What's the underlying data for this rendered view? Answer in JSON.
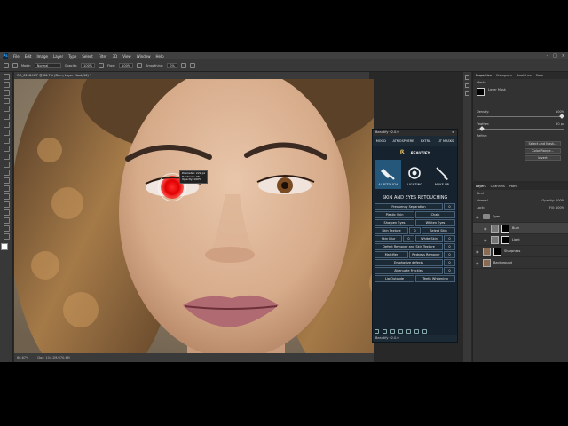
{
  "menubar": {
    "app_icon": "Ps",
    "items": [
      "File",
      "Edit",
      "Image",
      "Layer",
      "Type",
      "Select",
      "Filter",
      "3D",
      "View",
      "Window",
      "Help"
    ]
  },
  "options": {
    "mode_label": "Mode:",
    "mode_value": "Normal",
    "opacity_label": "Opacity:",
    "opacity_value": "100%",
    "flow_label": "Flow:",
    "flow_value": "100%",
    "smoothing_label": "Smoothing:",
    "smoothing_value": "0%"
  },
  "document": {
    "tab": "OO_0218.NEF @ 66.7% (Burn, Layer Mask/16) *",
    "zoom": "66.67%",
    "doc_info": "Doc: 104.2M/370.4M"
  },
  "brush_tip": {
    "line1": "Diameter: 222 px",
    "line2": "Hardness: 0%",
    "line3": "Opacity: 100%"
  },
  "beautify": {
    "title": "Beautify v2.0.0",
    "tabs": [
      "MOOD",
      "ATMOSPHERE",
      "EXTRA",
      "LIT MASKS"
    ],
    "logo": "BEAUTIFY",
    "modes": [
      {
        "label": "AI RETOUCH"
      },
      {
        "label": "LIGHTING"
      },
      {
        "label": "MAKE-UP"
      }
    ],
    "section": "SKIN AND EYES RETOUCHING",
    "rows": [
      [
        {
          "label": "Frequency Separation",
          "w": 2
        },
        {
          "label": "0",
          "num": true
        }
      ],
      [
        {
          "label": "Plastic Skin"
        },
        {
          "label": "Chalk"
        }
      ],
      [
        {
          "label": "Sharpen Eyes"
        },
        {
          "label": "Whiten Eyes"
        }
      ],
      [
        {
          "label": "Skin Texture"
        },
        {
          "label": "0",
          "num": true
        },
        {
          "label": "Select Skin"
        }
      ],
      [
        {
          "label": "Skin Blur"
        },
        {
          "label": "0",
          "num": true
        },
        {
          "label": "White Skin"
        },
        {
          "label": "0",
          "num": true
        }
      ],
      [
        {
          "label": "Defect Remover and Skin Texture",
          "w": 2
        },
        {
          "label": "0",
          "num": true
        }
      ],
      [
        {
          "label": "Mattifier"
        },
        {
          "label": "Redness Remover"
        },
        {
          "label": "0",
          "num": true
        }
      ],
      [
        {
          "label": "Emphasize defects",
          "w": 2
        },
        {
          "label": "0",
          "num": true
        }
      ],
      [
        {
          "label": "Attenuate Freckles",
          "w": 2
        },
        {
          "label": "0",
          "num": true
        }
      ],
      [
        {
          "label": "Lip Outcode"
        },
        {
          "label": "Teeth Whitening"
        }
      ]
    ],
    "footer": "Beautify v2.0.0"
  },
  "properties": {
    "tabs": [
      "Properties",
      "Histogram",
      "Swatches",
      "Color"
    ],
    "mode": "Masks",
    "layer_mask": "Layer Mask",
    "density_label": "Density:",
    "density_value": "100%",
    "feather_label": "Feather:",
    "feather_value": "50 px",
    "refine_label": "Refine:",
    "select_mask": "Select and Mask...",
    "color_range": "Color Range...",
    "invert": "Invert"
  },
  "layers": {
    "tabs": [
      "Layers",
      "Channels",
      "Paths"
    ],
    "kind": "Kind",
    "blend": "Normal",
    "opacity_label": "Opacity:",
    "opacity_value": "100%",
    "lock_label": "Lock:",
    "fill_label": "Fill:",
    "fill_value": "100%",
    "items": [
      {
        "name": "Eyes",
        "type": "group"
      },
      {
        "name": "Burn",
        "type": "layer",
        "selected": true
      },
      {
        "name": "Light",
        "type": "layer"
      },
      {
        "name": "Sharpness",
        "type": "layer"
      },
      {
        "name": "Background",
        "type": "layer"
      }
    ]
  },
  "colors": {
    "accent": "#31a8ff",
    "beautify_active": "#25577b",
    "brush": "#ff0000"
  }
}
